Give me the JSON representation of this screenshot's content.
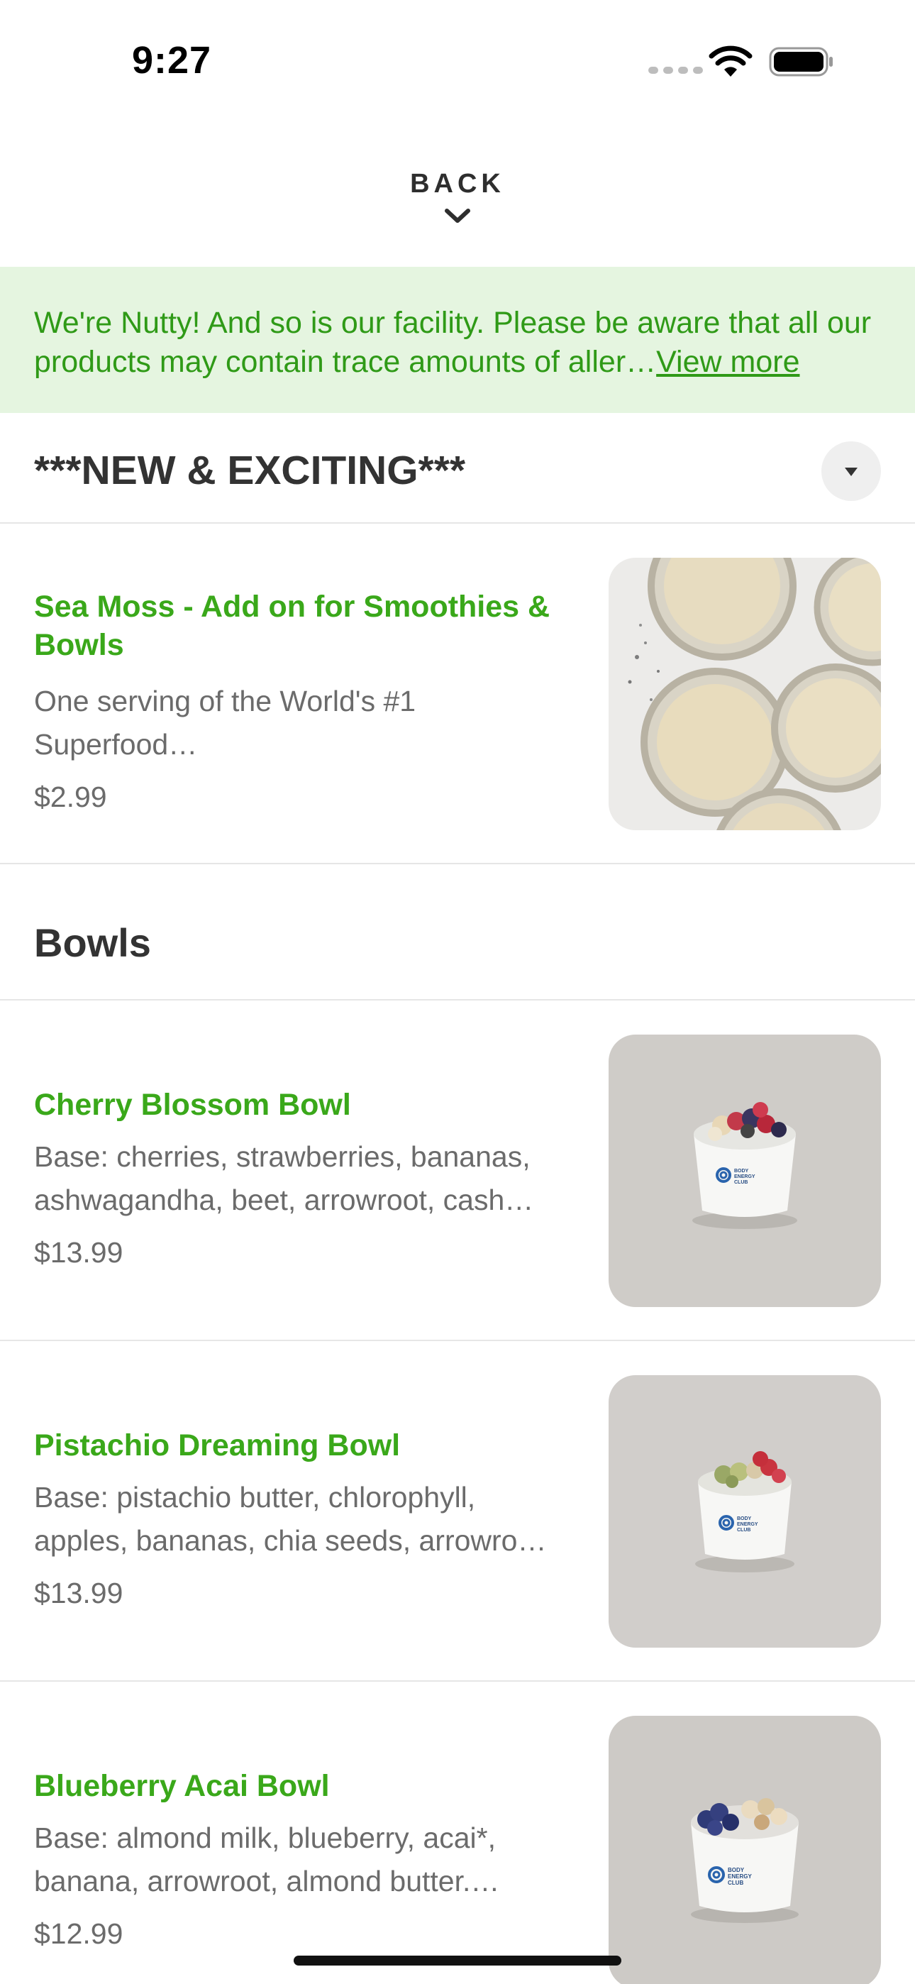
{
  "status_bar": {
    "time": "9:27"
  },
  "back": {
    "label": "BACK"
  },
  "banner": {
    "text": "We're Nutty! And so is our facility. Please be aware that all our products may contain trace amounts of aller…",
    "link": "View more"
  },
  "sections": {
    "new": {
      "title": "***NEW & EXCITING***",
      "items": [
        {
          "name": "Sea Moss - Add on for Smoothies & Bowls",
          "description": "One serving of the World's #1 Superfood…",
          "price": "$2.99"
        }
      ]
    },
    "bowls": {
      "title": "Bowls",
      "items": [
        {
          "name": "Cherry Blossom Bowl",
          "description": "Base: cherries, strawberries, bananas, ashwagandha, beet, arrowroot, cash…",
          "price": "$13.99"
        },
        {
          "name": "Pistachio Dreaming Bowl",
          "description": "Base: pistachio butter, chlorophyll, apples, bananas, chia seeds, arrowro…",
          "price": "$13.99"
        },
        {
          "name": "Blueberry Acai Bowl",
          "description": "Base: almond milk, blueberry, acai*, banana, arrowroot, almond butter.…",
          "price": "$12.99"
        }
      ]
    }
  },
  "cup_brand": "BODY ENERGY CLUB",
  "icons": {
    "back": "chevron-down-icon",
    "collapse": "caret-down-icon",
    "wifi": "wifi-icon",
    "battery": "battery-icon"
  },
  "colors": {
    "accent_green": "#3aa81a",
    "banner_bg": "#e5f5e0",
    "banner_text": "#2f9a17",
    "text_dark": "#333333",
    "text_gray": "#6b6b6b"
  }
}
